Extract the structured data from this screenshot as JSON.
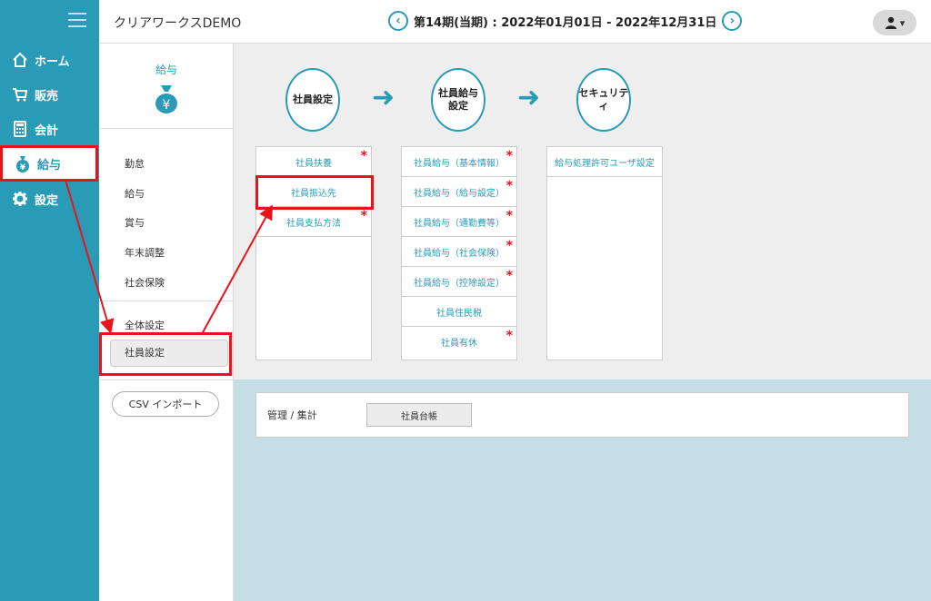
{
  "header": {
    "app_title": "クリアワークスDEMO",
    "period_prev_icon": "chevron-left-icon",
    "period_label": "第14期(当期) : 2022年01月01日 - 2022年12月31日",
    "period_next_icon": "chevron-right-icon",
    "user_icon": "user-icon",
    "user_caret": "▾"
  },
  "sidebar": {
    "menu_icon": "hamburger-icon",
    "items": [
      {
        "label": "ホーム",
        "icon": "home-icon"
      },
      {
        "label": "販売",
        "icon": "cart-icon"
      },
      {
        "label": "会計",
        "icon": "calculator-icon"
      },
      {
        "label": "給与",
        "icon": "money-bag-icon",
        "active": true
      },
      {
        "label": "設定",
        "icon": "gear-icon"
      }
    ]
  },
  "submenu": {
    "heading": "給与",
    "heading_icon": "money-bag-icon",
    "items_group1": [
      "勤怠",
      "給与",
      "賞与",
      "年末調整",
      "社会保険"
    ],
    "items_group2": [
      "全体設定",
      "社員設定"
    ],
    "selected": "社員設定",
    "csv_button": "CSV インポート"
  },
  "flow": {
    "steps": [
      "社員設定",
      "社員給与\n設定",
      "セキュリティ"
    ],
    "arrow_icon": "arrow-right-icon"
  },
  "panels": {
    "employee": [
      {
        "label": "社員扶養",
        "required": true
      },
      {
        "label": "社員振込先",
        "required": false,
        "highlighted": true
      },
      {
        "label": "社員支払方法",
        "required": true
      }
    ],
    "salary": [
      {
        "label": "社員給与（基本情報）",
        "required": true
      },
      {
        "label": "社員給与（給与設定）",
        "required": true
      },
      {
        "label": "社員給与（通勤費等）",
        "required": true
      },
      {
        "label": "社員給与（社会保険）",
        "required": true
      },
      {
        "label": "社員給与（控除設定）",
        "required": true
      },
      {
        "label": "社員住民税",
        "required": false
      },
      {
        "label": "社員有休",
        "required": true
      }
    ],
    "security": [
      {
        "label": "給与処理許可ユーザ設定",
        "required": false
      }
    ],
    "required_mark": "*"
  },
  "report": {
    "label": "管理 / 集計",
    "button": "社員台帳"
  },
  "colors": {
    "brand": "#2a9bb7",
    "highlight": "#e8141c"
  }
}
